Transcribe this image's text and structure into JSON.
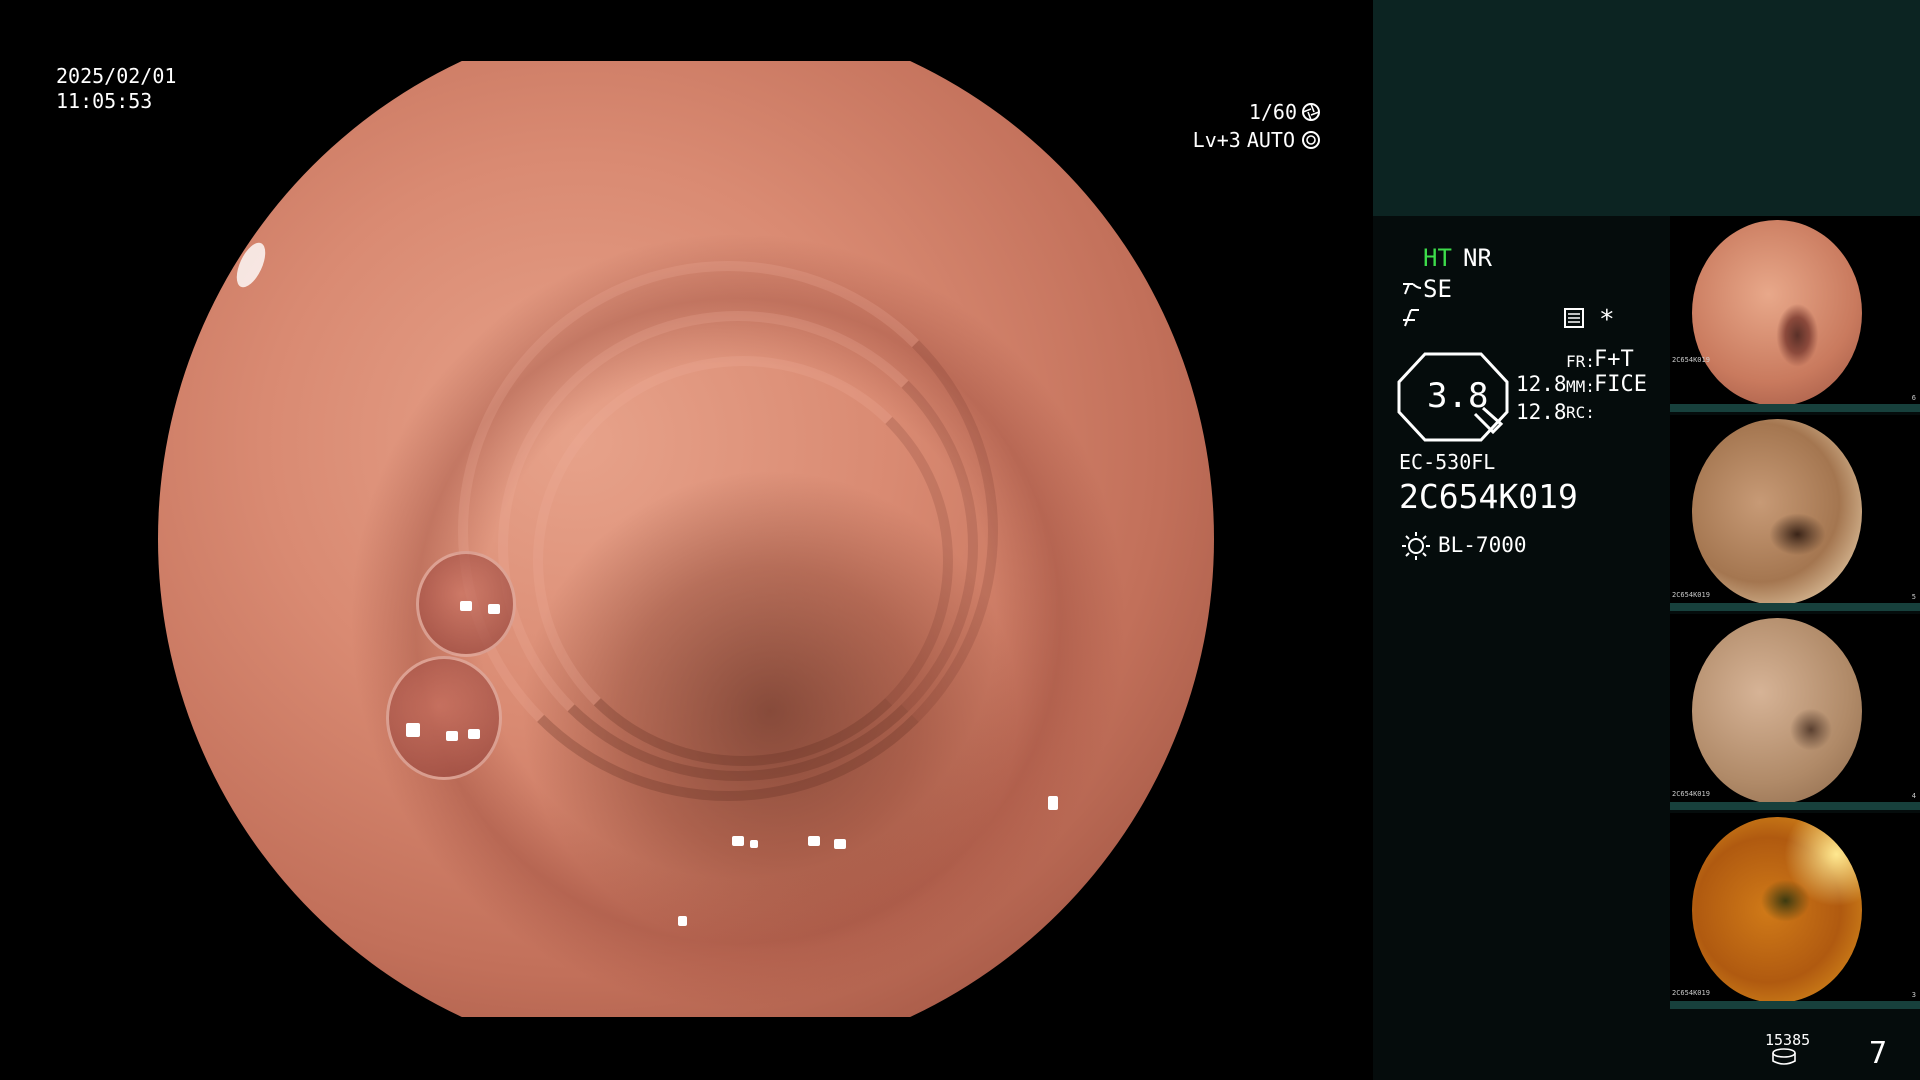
{
  "view": {
    "date": "2025/02/01",
    "time": "11:05:53",
    "shutter": "1/60",
    "level": "Lv+3",
    "exposure_mode": "AUTO",
    "shutter_icon": "shutter-icon",
    "iris_icon": "iris-icon"
  },
  "panel": {
    "ht": "HT",
    "nr": "NR",
    "se": "SE",
    "menu_icon": "settings-menu-icon",
    "star": "*",
    "zoom_value": "3.8",
    "line1_value": "12.8",
    "line2_value": "12.8",
    "fr_label": "FR:",
    "fr_value": "F+T",
    "mm_label": "MM:",
    "mm_value": "FICE",
    "rc_label": "RC:",
    "scope_model": "EC-530FL",
    "serial": "2C654K019",
    "light_source": "BL-7000",
    "storage_count": "15385",
    "capture_count": "7",
    "ht_color": "#3ddc4a"
  },
  "thumbnails": [
    {
      "id": "thumb-1",
      "serial": "2C654K019",
      "index": "6",
      "tone": "pink"
    },
    {
      "id": "thumb-2",
      "serial": "2C654K019",
      "index": "5",
      "tone": "tan"
    },
    {
      "id": "thumb-3",
      "serial": "2C654K019",
      "index": "4",
      "tone": "beige"
    },
    {
      "id": "thumb-4",
      "serial": "2C654K019",
      "index": "3",
      "tone": "orange"
    }
  ]
}
